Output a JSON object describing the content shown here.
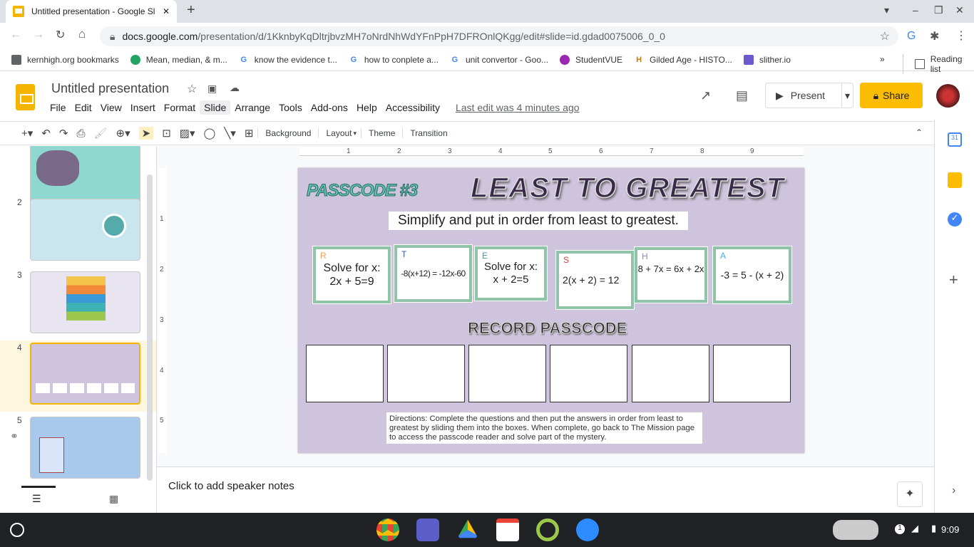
{
  "browser": {
    "tab_title": "Untitled presentation - Google Sl",
    "url_domain": "docs.google.com",
    "url_path": "/presentation/d/1KknbyKqDltrjbvzMH7oNrdNhWdYFnPpH7DFROnlQKgg/edit#slide=id.gdad0075006_0_0",
    "bookmarks": [
      {
        "label": "kernhigh.org bookmarks",
        "color": "#5f6368"
      },
      {
        "label": "Mean, median, & m...",
        "color": "#1fa463"
      },
      {
        "label": "know the evidence t...",
        "color": "#4285f4"
      },
      {
        "label": "how to conplete a...",
        "color": "#4285f4"
      },
      {
        "label": "unit convertor - Goo...",
        "color": "#4285f4"
      },
      {
        "label": "StudentVUE",
        "color": "#9c27b0"
      },
      {
        "label": "Gilded Age - HISTO...",
        "color": "#c67c00"
      },
      {
        "label": "slither.io",
        "color": "#6a5acd"
      }
    ],
    "reading_list": "Reading list"
  },
  "app": {
    "title": "Untitled presentation",
    "menu": [
      "File",
      "Edit",
      "View",
      "Insert",
      "Format",
      "Slide",
      "Arrange",
      "Tools",
      "Add-ons",
      "Help",
      "Accessibility"
    ],
    "last_edit": "Last edit was 4 minutes ago",
    "present": "Present",
    "share": "Share"
  },
  "toolbar": {
    "background": "Background",
    "layout": "Layout",
    "theme": "Theme",
    "transition": "Transition"
  },
  "filmstrip": {
    "slides": [
      {
        "num": "2"
      },
      {
        "num": "3"
      },
      {
        "num": "4",
        "selected": true
      },
      {
        "num": "5"
      }
    ]
  },
  "ruler": {
    "top": [
      "1",
      "2",
      "3",
      "4",
      "5",
      "6",
      "7",
      "8",
      "9"
    ],
    "left": [
      "1",
      "2",
      "3",
      "4",
      "5"
    ]
  },
  "slide": {
    "passcode": "PASSCODE #3",
    "title": "LEAST TO GREATEST",
    "instruction": "Simplify and put in order from least to greatest.",
    "cards": [
      {
        "letter": "R",
        "letter_color": "#f0a050",
        "text": "Solve for x:\n2x + 5=9"
      },
      {
        "letter": "T",
        "letter_color": "#3a5a9a",
        "text": "-8(x+12) = -12x-60"
      },
      {
        "letter": "E",
        "letter_color": "#3aa0a0",
        "text": "Solve for x:\nx + 2=5"
      },
      {
        "letter": "S",
        "letter_color": "#d04040",
        "text": "2(x + 2) = 12"
      },
      {
        "letter": "H",
        "letter_color": "#9a80c0",
        "text": "8 + 7x = 6x + 2x"
      },
      {
        "letter": "A",
        "letter_color": "#40b0e0",
        "text": "-3 = 5 - (x + 2)"
      }
    ],
    "record": "RECORD PASSCODE",
    "directions": "Directions: Complete the questions and then put the answers in order from least to greatest by sliding them into the boxes. When complete, go back to The Mission page to access the passcode reader and solve part of the mystery."
  },
  "notes": {
    "placeholder": "Click to add speaker notes"
  },
  "taskbar": {
    "time": "9:09",
    "notification_count": "1"
  }
}
